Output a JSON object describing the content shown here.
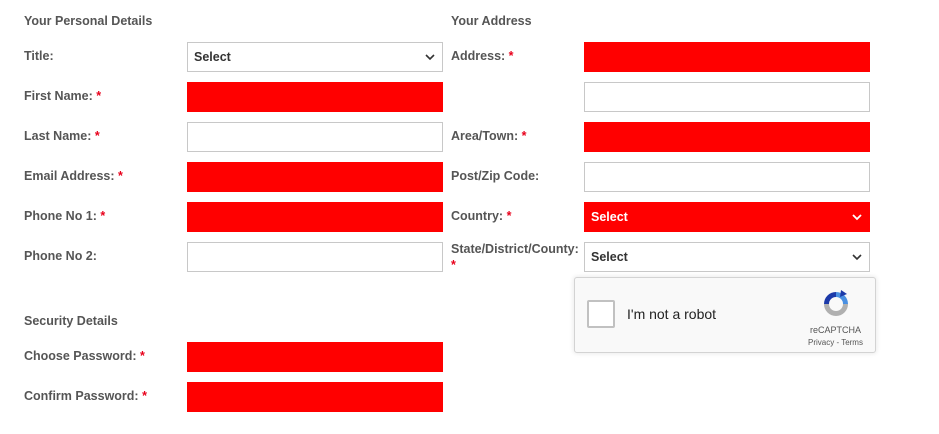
{
  "personal": {
    "title": "Your Personal Details",
    "title_label": "Title:",
    "title_select": "Select",
    "first_name_label": "First Name:",
    "last_name_label": "Last Name:",
    "email_label": "Email Address:",
    "phone1_label": "Phone No 1:",
    "phone2_label": "Phone No 2:"
  },
  "address": {
    "title": "Your Address",
    "address_label": "Address:",
    "area_label": "Area/Town:",
    "postcode_label": "Post/Zip Code:",
    "country_label": "Country:",
    "country_select": "Select",
    "state_label": "State/District/County:",
    "state_select": "Select"
  },
  "security": {
    "title": "Security Details",
    "password_label": "Choose Password:",
    "confirm_label": "Confirm Password:"
  },
  "required_marker": "*",
  "recaptcha": {
    "label": "I'm not a robot",
    "brand": "reCAPTCHA",
    "links": "Privacy - Terms"
  },
  "colors": {
    "error": "#ff0000",
    "required": "#e8001b",
    "label": "#555555"
  }
}
